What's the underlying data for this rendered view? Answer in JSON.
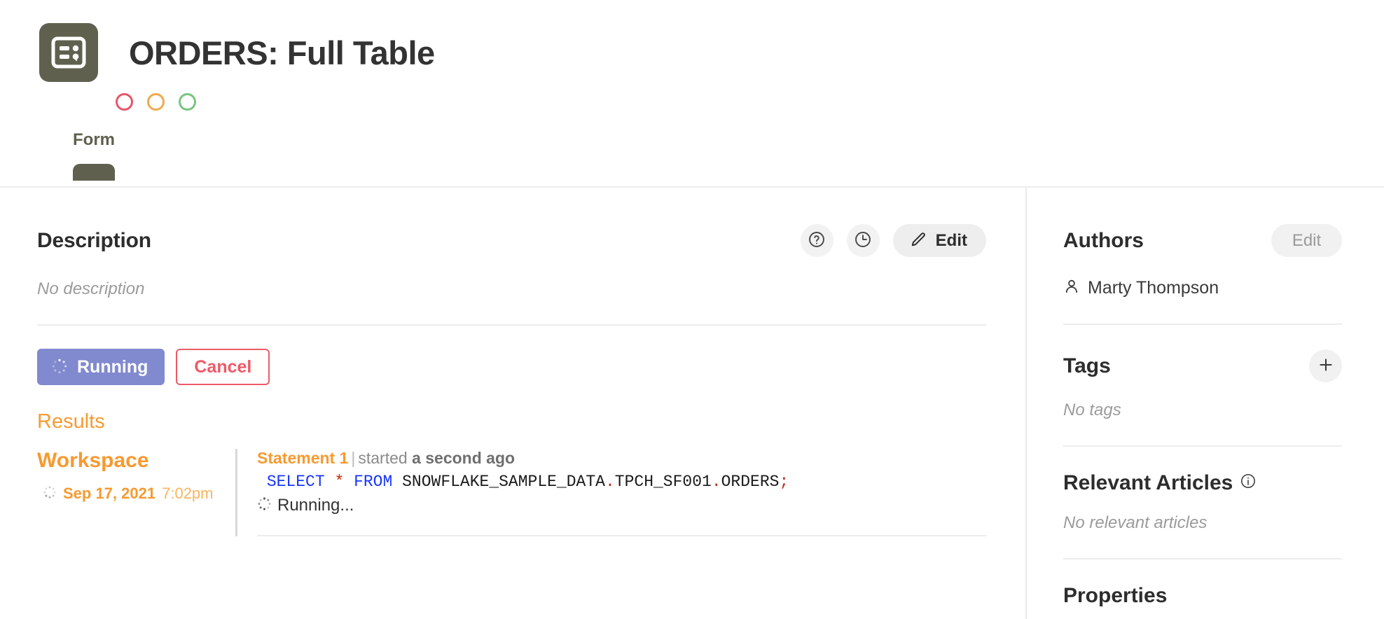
{
  "header": {
    "icon": "form-document-icon",
    "title": "ORDERS: Full Table",
    "window_controls": [
      {
        "name": "close",
        "color": "#e8556a"
      },
      {
        "name": "minimize",
        "color": "#eeab4e"
      },
      {
        "name": "maximize",
        "color": "#7ac47f"
      }
    ],
    "tabs": [
      {
        "label": "Form",
        "active": true
      }
    ]
  },
  "description": {
    "title": "Description",
    "body": "No description",
    "actions": {
      "help_icon": "question-circle-icon",
      "history_icon": "clock-icon",
      "edit_label": "Edit",
      "edit_icon": "pencil-icon"
    }
  },
  "run": {
    "running_label": "Running",
    "cancel_label": "Cancel",
    "running_color": "#8189cf",
    "cancel_color": "#ef5a68"
  },
  "results": {
    "title": "Results",
    "accent_color": "#f79a30",
    "workspace": {
      "name": "Workspace",
      "date": "Sep 17, 2021",
      "time": "7:02pm"
    },
    "statement": {
      "id_label": "Statement 1",
      "separator": "|",
      "started_label": "started",
      "relative_time": "a second ago",
      "sql": {
        "select": "SELECT",
        "star": "*",
        "from": "FROM",
        "table": "SNOWFLAKE_SAMPLE_DATA.TPCH_SF001.ORDERS",
        "terminator": ";",
        "full": "SELECT * FROM SNOWFLAKE_SAMPLE_DATA.TPCH_SF001.ORDERS;"
      },
      "status": "Running..."
    }
  },
  "sidebar": {
    "authors": {
      "title": "Authors",
      "edit_label": "Edit",
      "people": [
        {
          "name": "Marty Thompson",
          "icon": "person-icon"
        }
      ]
    },
    "tags": {
      "title": "Tags",
      "add_icon": "plus-icon",
      "empty": "No tags"
    },
    "relevant_articles": {
      "title": "Relevant Articles",
      "info_icon": "info-circle-icon",
      "empty": "No relevant articles"
    },
    "properties": {
      "title": "Properties"
    }
  }
}
